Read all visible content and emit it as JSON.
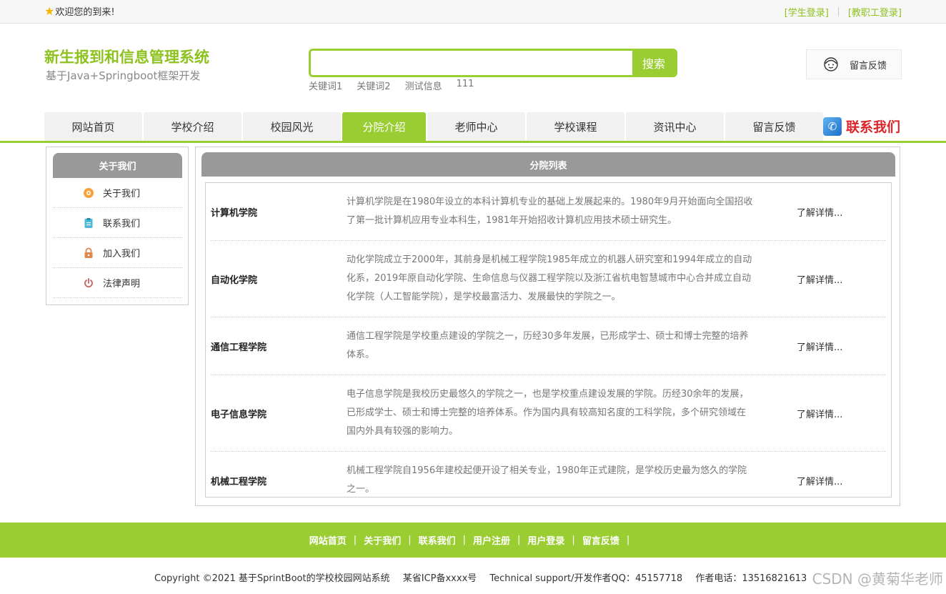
{
  "topbar": {
    "welcome": "欢迎您的到来!",
    "student_login": "[学生登录]",
    "staff_login": "[教职工登录]"
  },
  "header": {
    "title": "新生报到和信息管理系统",
    "subtitle": "基于Java+Springboot框架开发",
    "search_placeholder": "",
    "search_button": "搜索",
    "keywords": [
      "关键词1",
      "关键词2",
      "测试信息",
      "111"
    ],
    "feedback": "留言反馈"
  },
  "nav": {
    "items": [
      "网站首页",
      "学校介绍",
      "校园风光",
      "分院介绍",
      "老师中心",
      "学校课程",
      "资讯中心",
      "留言反馈"
    ],
    "active_index": 3,
    "contact": "联系我们"
  },
  "sidebar": {
    "title": "关于我们",
    "items": [
      {
        "label": "关于我们",
        "icon": "info-icon"
      },
      {
        "label": "联系我们",
        "icon": "clipboard-icon"
      },
      {
        "label": "加入我们",
        "icon": "lock-icon"
      },
      {
        "label": "法律声明",
        "icon": "power-icon"
      }
    ]
  },
  "main": {
    "title": "分院列表",
    "more_label": "了解详情...",
    "colleges": [
      {
        "name": "计算机学院",
        "desc": "计算机学院是在1980年设立的本科计算机专业的基础上发展起来的。1980年9月开始面向全国招收了第一批计算机应用专业本科生，1981年开始招收计算机应用技术硕士研究生。"
      },
      {
        "name": "自动化学院",
        "desc": "动化学院成立于2000年，其前身是机械工程学院1985年成立的机器人研究室和1994年成立的自动化系，2019年原自动化学院、生命信息与仪器工程学院以及浙江省杭电智慧城市中心合并成立自动化学院（人工智能学院），是学校最富活力、发展最快的学院之一。"
      },
      {
        "name": "通信工程学院",
        "desc": "通信工程学院是学校重点建设的学院之一，历经30多年发展，已形成学士、硕士和博士完整的培养体系。"
      },
      {
        "name": "电子信息学院",
        "desc": "电子信息学院是我校历史最悠久的学院之一，也是学校重点建设发展的学院。历经30余年的发展，已形成学士、硕士和博士完整的培养体系。作为国内具有较高知名度的工科学院，多个研究领域在国内外具有较强的影响力。"
      },
      {
        "name": "机械工程学院",
        "desc": "机械工程学院自1956年建校起便开设了相关专业，1980年正式建院，是学校历史最为悠久的学院之一。"
      }
    ]
  },
  "footer": {
    "links": [
      "网站首页",
      "关于我们",
      "联系我们",
      "用户注册",
      "用户登录",
      "留言反馈"
    ],
    "copyright": "Copyright ©2021 基于SprintBoot的学校校园网站系统",
    "icp": "某省ICP备xxxx号",
    "support": "Technical support/开发作者QQ：45157718",
    "phone": "作者电话：13516821613",
    "watermark": "CSDN @黄菊华老师"
  },
  "colors": {
    "accent": "#9acd32",
    "title_green": "#8dc21f",
    "panel_gray": "#999999",
    "contact_red": "#d8262a"
  }
}
